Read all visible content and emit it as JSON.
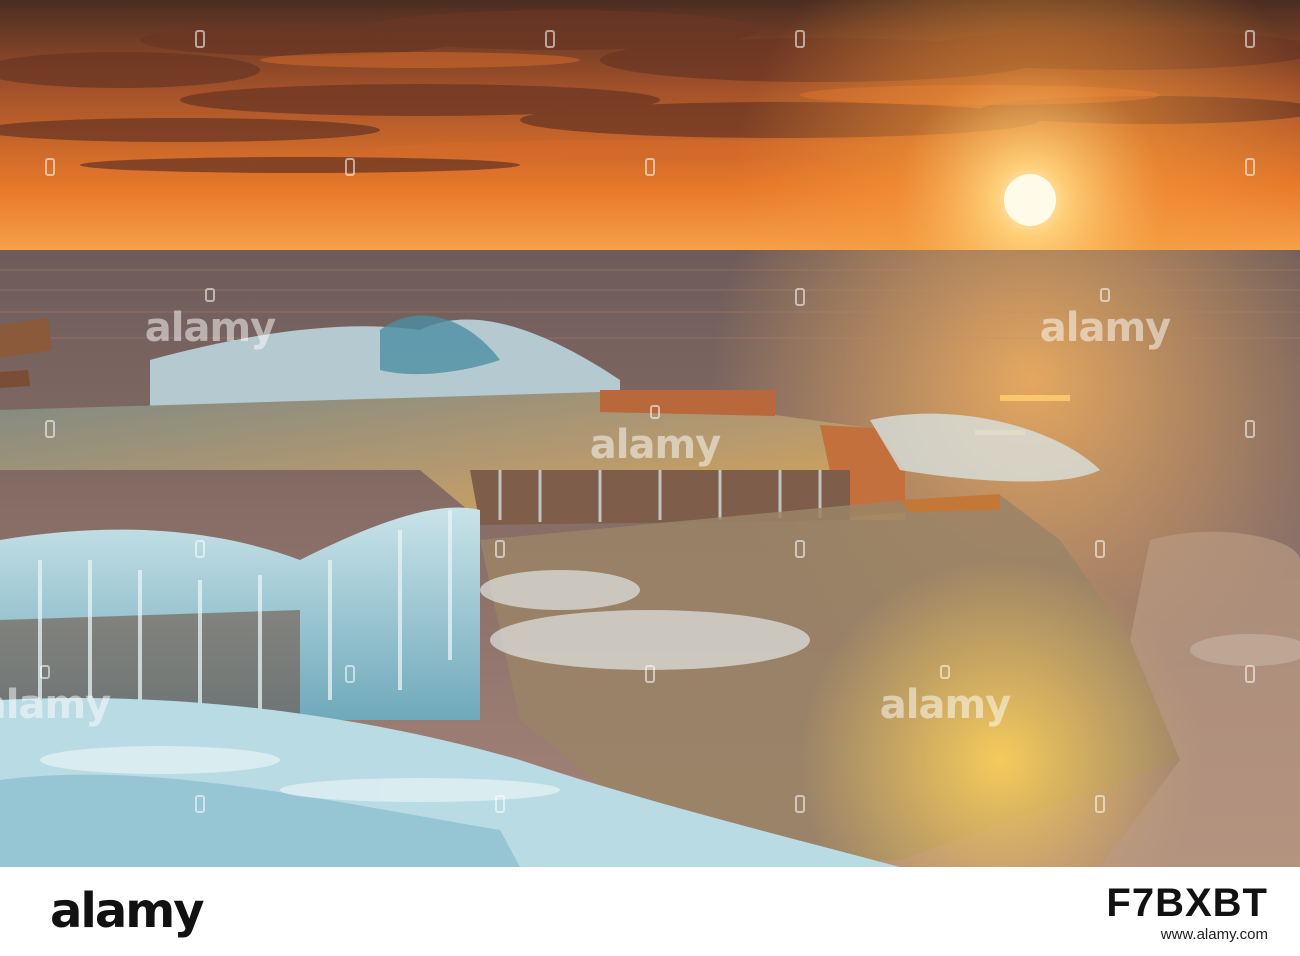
{
  "watermark": {
    "text": "alamy"
  },
  "footer": {
    "logo": "alamy",
    "site": "www.alamy.com",
    "image_code": "F7BXBT"
  },
  "colors": {
    "sky_top": "#5a3a2a",
    "sky_orange": "#f08a2a",
    "sun": "#fff4c8",
    "sea": "#7a6a66",
    "foam": "#d8eef2",
    "rock": "#a67c52"
  }
}
